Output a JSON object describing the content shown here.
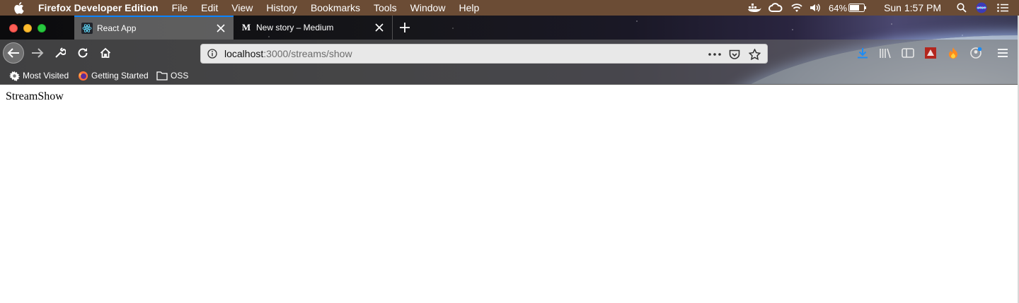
{
  "menubar": {
    "app_name": "Firefox Developer Edition",
    "menus": [
      "File",
      "Edit",
      "View",
      "History",
      "Bookmarks",
      "Tools",
      "Window",
      "Help"
    ],
    "battery_percent": "64%",
    "clock": "Sun 1:57 PM",
    "status_icons": [
      "docker-icon",
      "creative-cloud-icon",
      "wifi-icon",
      "volume-icon",
      "battery-icon",
      "spotlight-icon",
      "siri-icon",
      "notification-center-icon"
    ]
  },
  "tabs": [
    {
      "title": "React App",
      "favicon": "react-icon",
      "active": true
    },
    {
      "title": "New story – Medium",
      "favicon": "medium-icon",
      "favicon_text": "M",
      "active": false
    }
  ],
  "toolbar": {
    "url_host": "localhost",
    "url_path": ":3000/streams/show",
    "page_actions": [
      "more-actions-icon",
      "pocket-icon",
      "bookmark-star-icon"
    ],
    "right_icons": [
      "downloads-icon",
      "library-icon",
      "sidebar-icon",
      "extension-red-icon",
      "extension-fire-icon",
      "account-icon",
      "hamburger-menu-icon"
    ]
  },
  "bookmarks": [
    {
      "label": "Most Visited",
      "icon": "gear-icon"
    },
    {
      "label": "Getting Started",
      "icon": "firefox-icon"
    },
    {
      "label": "OSS",
      "icon": "folder-icon"
    }
  ],
  "page": {
    "text": "StreamShow"
  },
  "colors": {
    "menubar_bg": "#6b4c35",
    "tab_accent": "#0a84ff",
    "url_path": "#6c6c6c"
  }
}
